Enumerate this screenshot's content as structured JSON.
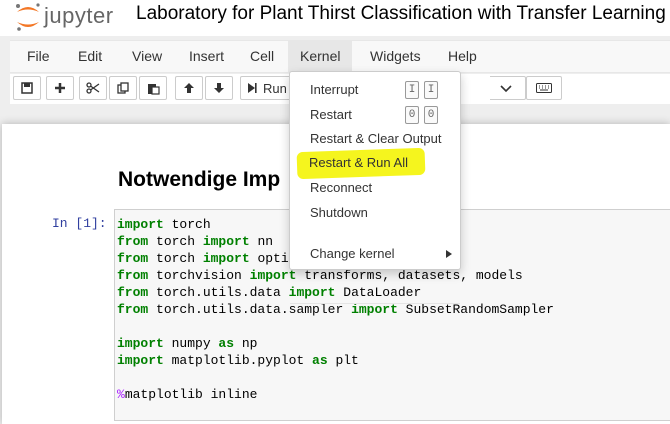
{
  "header": {
    "logo_text": "jupyter",
    "notebook_title": "Laboratory for Plant Thirst Classification with Transfer Learning"
  },
  "menu": {
    "file": "File",
    "edit": "Edit",
    "view": "View",
    "insert": "Insert",
    "cell": "Cell",
    "kernel": "Kernel",
    "widgets": "Widgets",
    "help": "Help"
  },
  "toolbar": {
    "run_label": "Run"
  },
  "kernel_menu": {
    "interrupt": "Interrupt",
    "interrupt_key_1": "I",
    "interrupt_key_2": "I",
    "restart": "Restart",
    "restart_key_1": "0",
    "restart_key_2": "0",
    "restart_clear": "Restart & Clear Output",
    "restart_run_all": "Restart & Run All",
    "reconnect": "Reconnect",
    "shutdown": "Shutdown",
    "change_kernel": "Change kernel"
  },
  "notebook": {
    "heading": "Notwendige Imp",
    "prompt": "In [1]:",
    "code": [
      "import torch",
      "from torch import nn",
      "from torch import opti",
      "from torchvision import transforms, datasets, models",
      "from torch.utils.data import DataLoader",
      "from torch.utils.data.sampler import SubsetRandomSampler",
      "",
      "import numpy as np",
      "import matplotlib.pyplot as plt",
      "",
      "%matplotlib inline"
    ]
  },
  "colors": {
    "highlight": "#f5f51e",
    "keyword": "#008000",
    "magic": "#aa22ff",
    "prompt": "#303f9f",
    "logo_orange": "#f37726"
  }
}
